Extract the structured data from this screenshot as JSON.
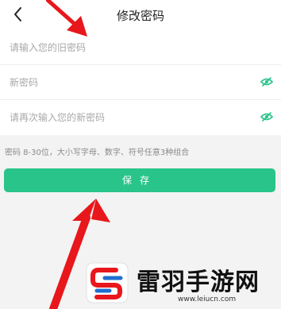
{
  "header": {
    "title": "修改密码",
    "back_icon": "chevron-left-icon"
  },
  "form": {
    "old_password": {
      "placeholder": "请输入您的旧密码"
    },
    "new_password": {
      "placeholder": "新密码",
      "icon": "eye-hidden-icon"
    },
    "confirm_password": {
      "placeholder": "请再次输入您的新密码",
      "icon": "eye-hidden-icon"
    }
  },
  "hint": "密码 8-30位，大小写字母、数字、符号任意3种组合",
  "save_label": "保存",
  "watermark": {
    "name": "雷羽手游网",
    "url": "www.leiucn.com"
  },
  "colors": {
    "accent": "#29c48a",
    "arrow": "#e8171c",
    "background": "#f3f3f3"
  }
}
